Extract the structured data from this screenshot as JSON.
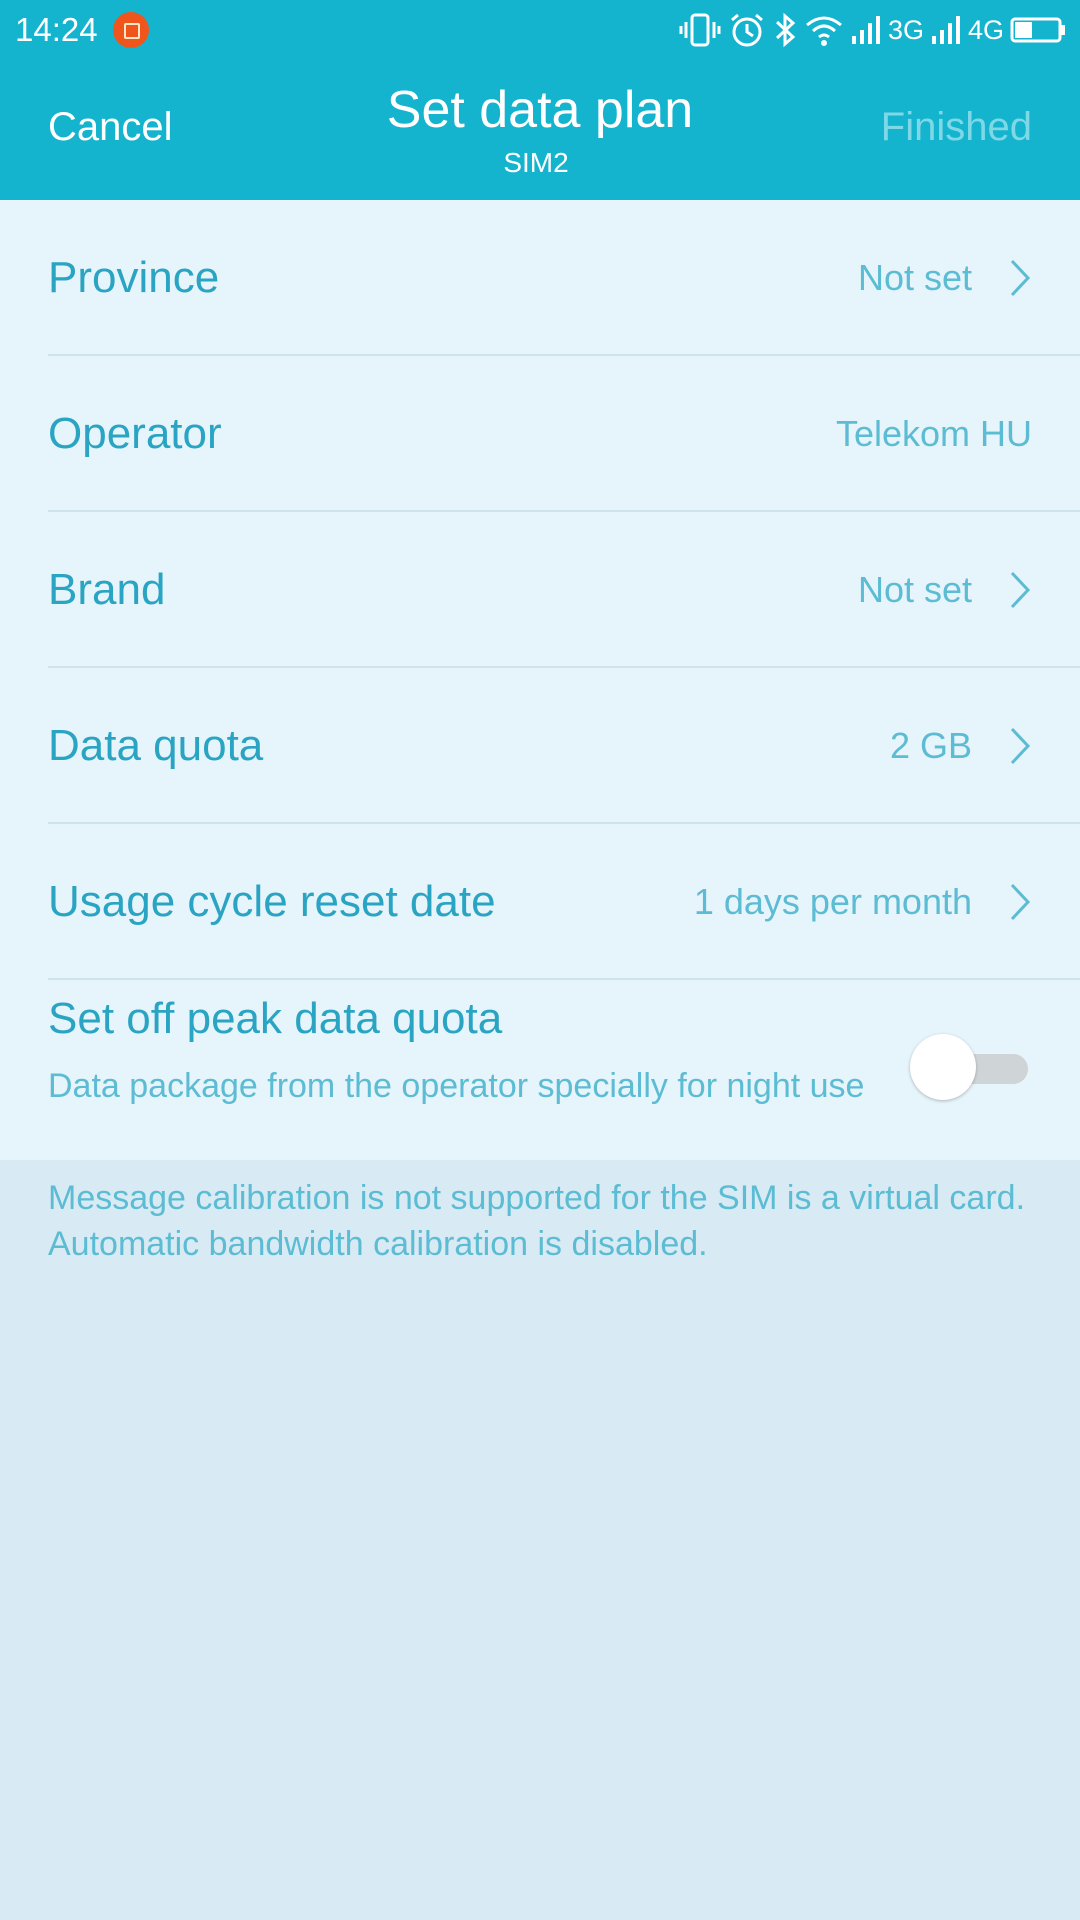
{
  "status_bar": {
    "time": "14:24",
    "net1": "3G",
    "net2": "4G",
    "battery_level": 0.4,
    "icons": [
      "notification-app-icon",
      "vibrate-icon",
      "alarm-icon",
      "bluetooth-icon",
      "wifi-icon",
      "signal-icon",
      "signal-icon",
      "battery-icon"
    ]
  },
  "header": {
    "cancel_label": "Cancel",
    "title": "Set data plan",
    "subtitle": "SIM2",
    "finished_label": "Finished"
  },
  "settings": {
    "province": {
      "label": "Province",
      "value": "Not set"
    },
    "operator": {
      "label": "Operator",
      "value": "Telekom HU"
    },
    "brand": {
      "label": "Brand",
      "value": "Not set"
    },
    "data_quota": {
      "label": "Data quota",
      "value": "2 GB"
    },
    "reset_date": {
      "label": "Usage cycle reset date",
      "value": "1 days per month"
    },
    "offpeak": {
      "label": "Set off peak data quota",
      "description": "Data package from the operator specially for night use",
      "enabled": false
    }
  },
  "note": "Message calibration is not supported for the SIM is a virtual card. Automatic bandwidth calibration is disabled.",
  "colors": {
    "accent": "#14b3ce",
    "label_text": "#2aa4c3",
    "value_text": "#5cbcd3",
    "list_bg": "#e6f4fb",
    "page_bg": "#d8eaf3"
  }
}
